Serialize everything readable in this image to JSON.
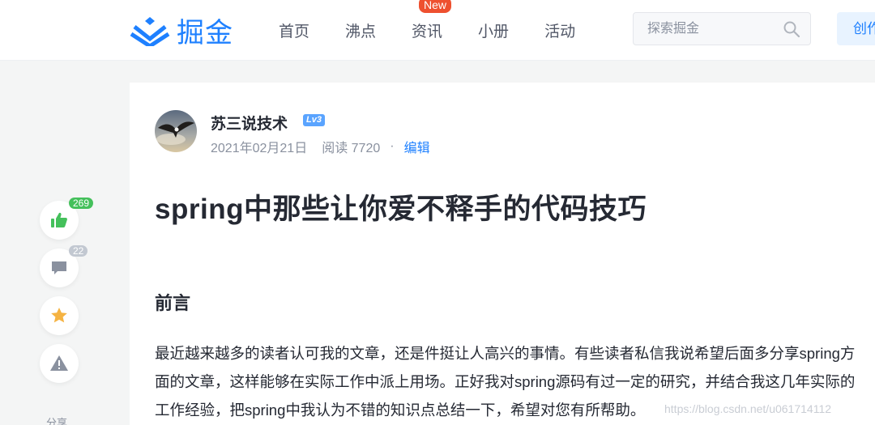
{
  "header": {
    "logo_text": "掘金",
    "nav": [
      {
        "label": "首页"
      },
      {
        "label": "沸点"
      },
      {
        "label": "资讯",
        "badge": "New"
      },
      {
        "label": "小册"
      },
      {
        "label": "活动"
      }
    ],
    "search_placeholder": "探索掘金",
    "create_label": "创作者中心"
  },
  "sidebar": {
    "like_count": "269",
    "comment_count": "22",
    "share_label": "分享"
  },
  "article": {
    "author": "苏三说技术",
    "level": "Lv3",
    "date": "2021年02月21日",
    "reads": "阅读 7720",
    "dot": "·",
    "edit_label": "编辑",
    "title": "spring中那些让你爱不释手的代码技巧",
    "section_heading": "前言",
    "paragraph": "最近越来越多的读者认可我的文章，还是件挺让人高兴的事情。有些读者私信我说希望后面多分享spring方面的文章，这样能够在实际工作中派上用场。正好我对spring源码有过一定的研究，并结合我这几年实际的工作经验，把spring中我认为不错的知识点总结一下，希望对您有所帮助。"
  },
  "watermark": "https://blog.csdn.net/u061714112",
  "colors": {
    "brand": "#1e80ff",
    "like_badge": "#44c05b",
    "comment_badge": "#c2c8d1",
    "new_badge": "#ee502f",
    "level_badge": "#5aa4ff"
  }
}
